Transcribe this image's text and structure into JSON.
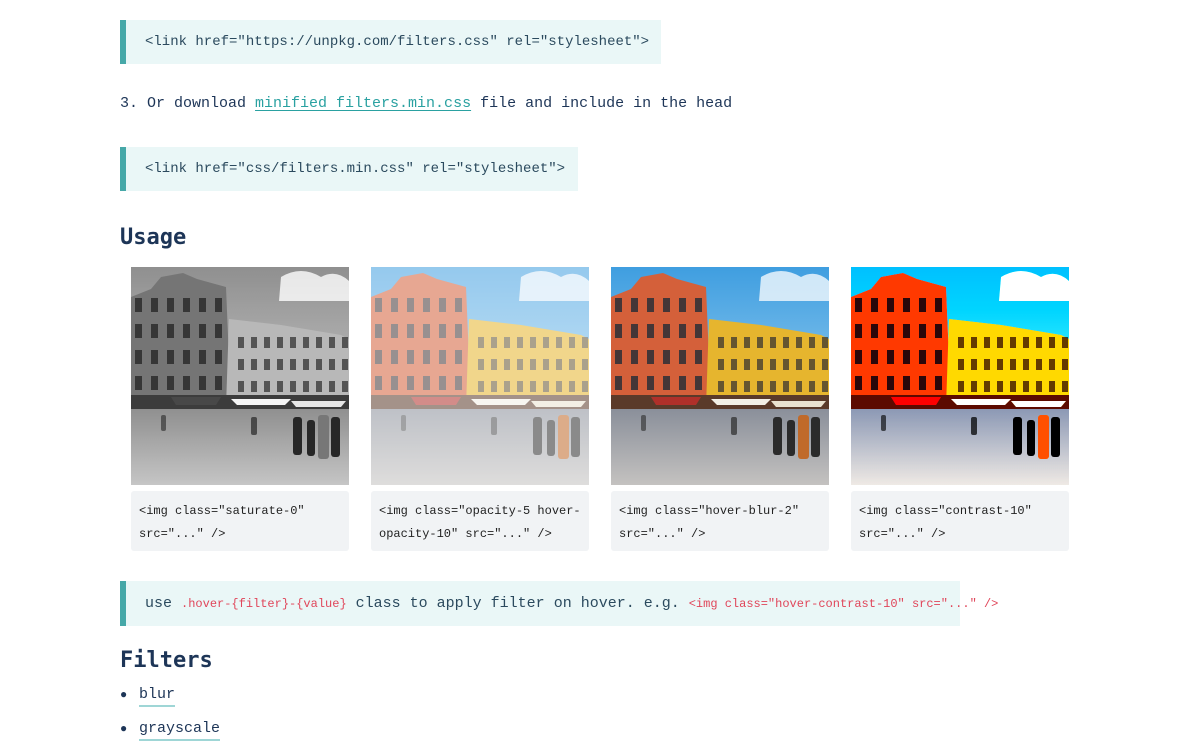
{
  "snippets": {
    "unpkg": "<link href=\"https://unpkg.com/filters.css\" rel=\"stylesheet\">",
    "local": "<link href=\"css/filters.min.css\" rel=\"stylesheet\">"
  },
  "step3": {
    "prefix": "3. Or download ",
    "link": "minified filters.min.css",
    "suffix": " file and include in the head"
  },
  "usage": {
    "title": "Usage",
    "cards": [
      {
        "code": "<img class=\"saturate-0\" src=\"...\" />",
        "filter": "grayscale"
      },
      {
        "code": "<img class=\"opacity-5 hover-opacity-10\" src=\"...\" />",
        "filter": "faded"
      },
      {
        "code": "<img class=\"hover-blur-2\" src=\"...\" />",
        "filter": "normal"
      },
      {
        "code": "<img class=\"contrast-10\" src=\"...\" />",
        "filter": "high-contrast"
      }
    ]
  },
  "hover_note": {
    "use": "use ",
    "pattern": ".hover-{filter}-{value}",
    "middle": " class to apply filter on hover. e.g. ",
    "example": "<img class=\"hover-contrast-10\" src=\"...\" />"
  },
  "filters": {
    "title": "Filters",
    "items": [
      "blur",
      "grayscale"
    ]
  },
  "colors": {
    "accent": "#46a8a8",
    "callout_bg": "#eaf7f7",
    "heading": "#1d3557",
    "code_highlight": "#e0465a"
  }
}
